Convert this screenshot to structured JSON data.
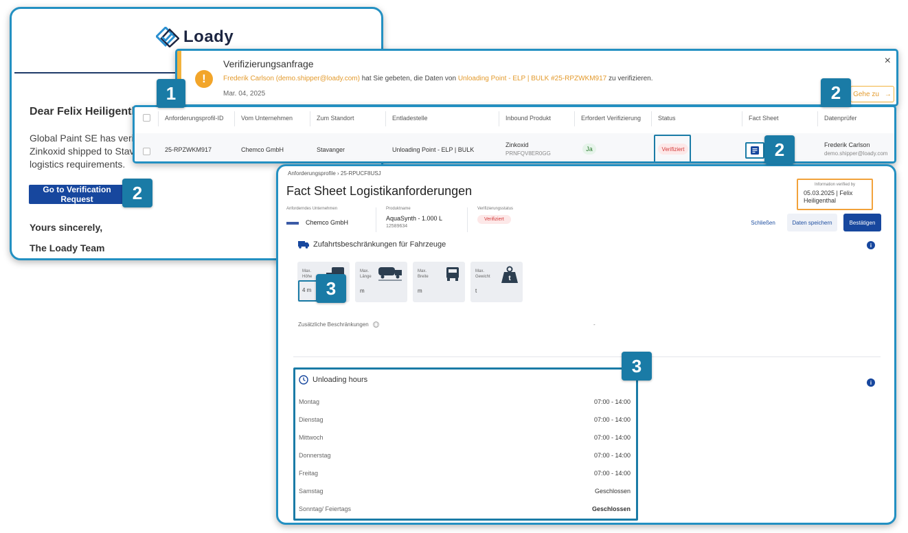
{
  "email": {
    "logo_text": "Loady",
    "greeting": "Dear Felix Heiligenthal,",
    "body_lines": [
      "Global Paint SE has verified",
      "Zinkoxid shipped to Stavanger",
      "logistics requirements."
    ],
    "button_label": "Go to Verification Request",
    "closing": "Yours sincerely,",
    "signature": "The Loady Team"
  },
  "notification": {
    "title": "Verifizierungsanfrage",
    "requester": "Frederik Carlson (demo.shipper@loady.com)",
    "text_middle": " hat Sie gebeten, die Daten von ",
    "target": "Unloading Point - ELP | BULK #25-RPZWKM917",
    "text_end": " zu verifizieren.",
    "date": "Mar. 04, 2025",
    "goto_label": "Gehe zu",
    "goto_arrow": "→",
    "close_icon": "×"
  },
  "table": {
    "headers": [
      "Anforderungsprofil-ID",
      "Vom Unternehmen",
      "Zum Standort",
      "Entladestelle",
      "Inbound Produkt",
      "Erfordert Verifizierung",
      "Status",
      "Fact Sheet",
      "Datenprüfer"
    ],
    "row": {
      "id": "25-RPZWKM917",
      "company": "Chemco GmbH",
      "location": "Stavanger",
      "unloading": "Unloading Point - ELP | BULK",
      "product": "Zinkoxid",
      "product_code": "PRNFQV8ER0GG",
      "requires": "Ja",
      "status": "Verifiziert",
      "reviewer": "Frederik Carlson",
      "reviewer_email": "demo.shipper@loady.com"
    }
  },
  "fact": {
    "breadcrumb": "Anforderungsprofile  ›  25-RPUCF8USJ",
    "title": "Fact Sheet Logistikanforderungen",
    "info_label": "Information verified by",
    "info_value": "05.03.2025 | Felix Heiligenthal",
    "company_label": "Anforderndes Unternehmen",
    "company_value": "Chemco GmbH",
    "product_label": "Produktname",
    "product_value": "AquaSynth - 1.000 L",
    "product_code": "12589634",
    "verif_label": "Verifizierungsstatus",
    "verif_value": "Verifiziert",
    "btn_close": "Schließen",
    "btn_save": "Daten speichern",
    "btn_confirm": "Bestätigen",
    "section1_title": "Zufahrtsbeschränkungen für Fahrzeuge",
    "cards": [
      {
        "label": "Max.\nHöhe",
        "value": "4 m",
        "icon": "truck-height-icon"
      },
      {
        "label": "Max.\nLänge",
        "value": "m",
        "icon": "truck-length-icon"
      },
      {
        "label": "Max.\nBreite",
        "value": "m",
        "icon": "truck-width-icon"
      },
      {
        "label": "Max.\nGewicht",
        "value": "t",
        "icon": "weight-icon"
      }
    ],
    "extra_label": "Zusätzliche Beschränkungen",
    "extra_value": "-",
    "section2_title": "Unloading hours",
    "hours": [
      {
        "day": "Montag",
        "time": "07:00 - 14:00"
      },
      {
        "day": "Dienstag",
        "time": "07:00 - 14:00"
      },
      {
        "day": "Mittwoch",
        "time": "07:00 - 14:00"
      },
      {
        "day": "Donnerstag",
        "time": "07:00 - 14:00"
      },
      {
        "day": "Freitag",
        "time": "07:00 - 14:00"
      },
      {
        "day": "Samstag",
        "time": "Geschlossen"
      },
      {
        "day": "Sonntag/ Feiertags",
        "time": "Geschlossen"
      }
    ]
  },
  "badges": [
    "1",
    "2",
    "2",
    "2",
    "3",
    "3"
  ],
  "colors": {
    "accent": "#1a7ba6",
    "brand": "#17479e",
    "warning": "#f2b33d",
    "verified_red": "#d33a3a"
  }
}
